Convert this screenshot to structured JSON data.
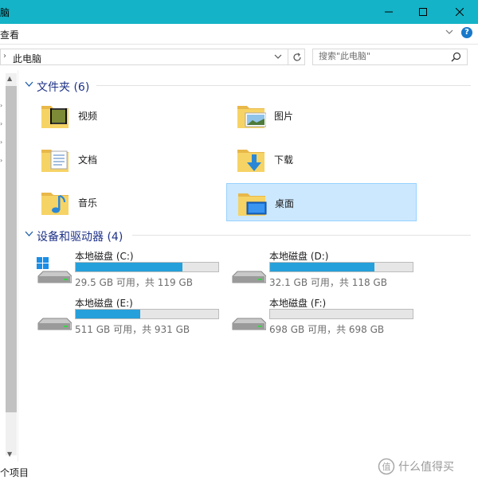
{
  "window": {
    "title_fragment": "脑",
    "minimize_icon": "minimize-icon",
    "maximize_icon": "maximize-icon",
    "close_icon": "close-icon",
    "titlebar_color": "#14b3c7"
  },
  "ribbon": {
    "tab_view": "查看"
  },
  "address": {
    "separator": "›",
    "path": "此电脑"
  },
  "search": {
    "placeholder": "搜索\"此电脑\""
  },
  "sections": {
    "folders_title": "文件夹 (6)",
    "drives_title": "设备和驱动器 (4)"
  },
  "folders": [
    {
      "name": "视频",
      "icon": "video-folder-icon"
    },
    {
      "name": "图片",
      "icon": "pictures-folder-icon"
    },
    {
      "name": "文档",
      "icon": "documents-folder-icon"
    },
    {
      "name": "下载",
      "icon": "downloads-folder-icon"
    },
    {
      "name": "音乐",
      "icon": "music-folder-icon"
    },
    {
      "name": "桌面",
      "icon": "desktop-folder-icon",
      "selected": true
    }
  ],
  "drives": [
    {
      "name": "本地磁盘 (C:)",
      "free_text": "29.5 GB 可用，共 119 GB",
      "used_fraction": 0.75,
      "icon": "windows-drive-icon"
    },
    {
      "name": "本地磁盘 (D:)",
      "free_text": "32.1 GB 可用，共 118 GB",
      "used_fraction": 0.73,
      "icon": "hard-drive-icon"
    },
    {
      "name": "本地磁盘 (E:)",
      "free_text": "511 GB 可用，共 931 GB",
      "used_fraction": 0.45,
      "icon": "hard-drive-icon"
    },
    {
      "name": "本地磁盘 (F:)",
      "free_text": "698 GB 可用，共 698 GB",
      "used_fraction": 0.0,
      "icon": "hard-drive-icon"
    }
  ],
  "status": {
    "item_count_fragment": "个项目"
  },
  "watermark": {
    "text": "什么值得买"
  }
}
